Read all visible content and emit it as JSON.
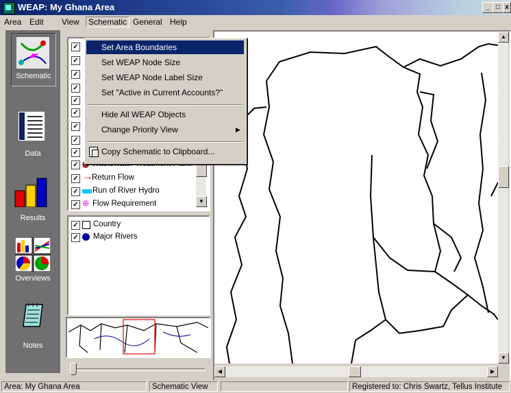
{
  "window": {
    "title": "WEAP: My Ghana Area"
  },
  "menubar": {
    "items": [
      {
        "label": "Area"
      },
      {
        "label": "Edit"
      },
      {
        "label": "View"
      },
      {
        "label": "Schematic"
      },
      {
        "label": "General"
      },
      {
        "label": "Help"
      }
    ]
  },
  "toolbar": {
    "views": [
      {
        "label": "Schematic",
        "icon": "schematic-icon"
      },
      {
        "label": "Data",
        "icon": "data-icon"
      },
      {
        "label": "Results",
        "icon": "results-icon"
      },
      {
        "label": "Overviews",
        "icon": "overviews-icon"
      },
      {
        "label": "Notes",
        "icon": "notes-icon"
      }
    ]
  },
  "schematic_menu": {
    "items": [
      {
        "label": "Set Area Boundaries",
        "highlighted": true
      },
      {
        "label": "Set WEAP Node Size"
      },
      {
        "label": "Set WEAP Node Label Size"
      },
      {
        "label": "Set \"Active in Current Accounts?\""
      },
      {
        "label": "Hide All WEAP Objects"
      },
      {
        "label": "Change Priority View",
        "submenu": true
      },
      {
        "label": "Copy Schematic to Clipboard...",
        "icon": "copy-icon"
      }
    ]
  },
  "legend_weap": {
    "items": [
      {
        "label": "Wastewater Treatment Plant",
        "checked": true,
        "symbol_color": "#a03030"
      },
      {
        "label": "Return Flow",
        "checked": true,
        "symbol_color": "#ff0000"
      },
      {
        "label": "Run of River Hydro",
        "checked": true,
        "symbol_color": "#00c8ff"
      },
      {
        "label": "Flow Requirement",
        "checked": true,
        "symbol_color": "#ff00ff"
      }
    ]
  },
  "legend_gis": {
    "items": [
      {
        "label": "Country",
        "checked": true
      },
      {
        "label": "Major Rivers",
        "checked": true,
        "symbol_color": "#0000a0"
      }
    ]
  },
  "statusbar": {
    "area": "Area: My Ghana Area",
    "view": "Schematic View",
    "registered": "Registered to: Chris Swartz, Tellus Institute"
  },
  "colors": {
    "title_bar": "#0a246a",
    "menu_highlight": "#0a246a",
    "toolbar_bg": "#707070",
    "border_line": "#000000"
  }
}
